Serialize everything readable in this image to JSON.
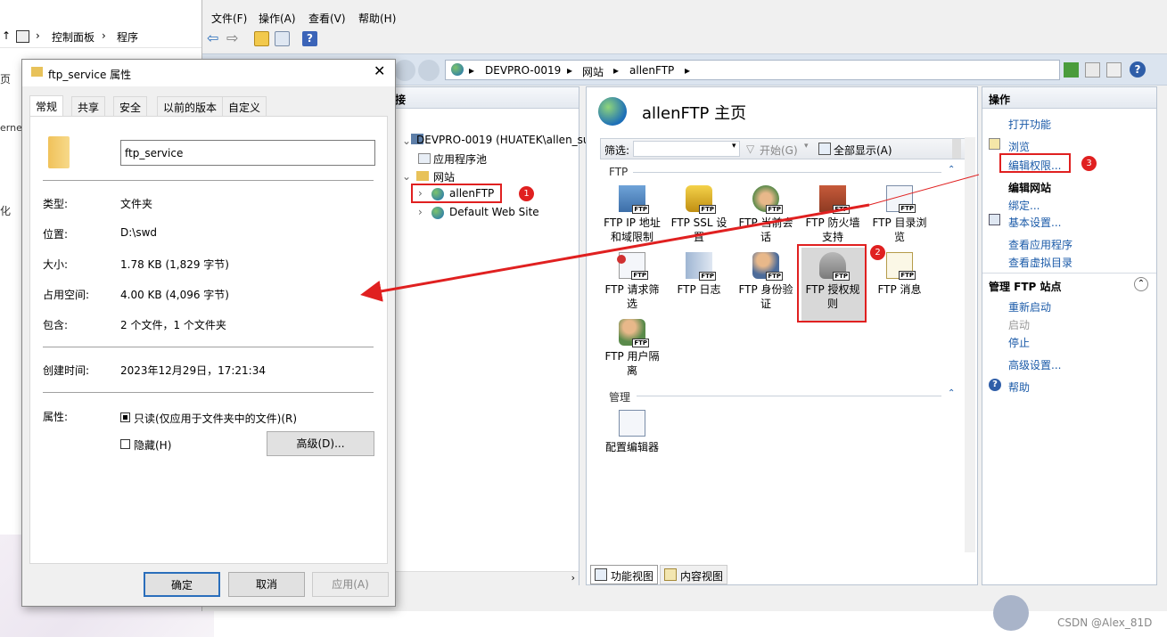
{
  "control_panel": {
    "breadcrumb": [
      "控制面板",
      "程序"
    ],
    "side": [
      "页",
      "ernet",
      "化"
    ]
  },
  "iis": {
    "menu": [
      "文件(F)",
      "操作(A)",
      "查看(V)",
      "帮助(H)"
    ],
    "address": [
      "DEVPRO-0019",
      "网站",
      "allenFTP"
    ],
    "connections": {
      "title": "接",
      "tree": [
        "DEVPRO-0019 (HUATEK\\allen_su",
        "应用程序池",
        "网站",
        "allenFTP",
        "Default Web Site"
      ]
    },
    "center": {
      "title": "allenFTP 主页",
      "filter_label": "筛选:",
      "start_label": "开始(G)",
      "showall_label": "全部显示(A)",
      "section_ftp": "FTP",
      "section_manage": "管理",
      "features": [
        "FTP IP 地址和域限制",
        "FTP SSL 设置",
        "FTP 当前会话",
        "FTP 防火墙支持",
        "FTP 目录浏览",
        "FTP 请求筛选",
        "FTP 日志",
        "FTP 身份验证",
        "FTP 授权规则",
        "FTP 消息",
        "FTP 用户隔离"
      ],
      "manage_features": [
        "配置编辑器"
      ],
      "tabs": [
        "功能视图",
        "内容视图"
      ]
    },
    "actions": {
      "title": "操作",
      "open_feature": "打开功能",
      "browse": "浏览",
      "edit_permissions": "编辑权限...",
      "edit_site_header": "编辑网站",
      "bindings": "绑定...",
      "basic_settings": "基本设置...",
      "view_apps": "查看应用程序",
      "view_vdirs": "查看虚拟目录",
      "manage_header": "管理 FTP 站点",
      "restart": "重新启动",
      "start": "启动",
      "stop": "停止",
      "advanced": "高级设置...",
      "help": "帮助"
    }
  },
  "dialog": {
    "title": "ftp_service 属性",
    "tabs": [
      "常规",
      "共享",
      "安全",
      "以前的版本",
      "自定义"
    ],
    "name": "ftp_service",
    "fields": [
      {
        "label": "类型:",
        "value": "文件夹"
      },
      {
        "label": "位置:",
        "value": "D:\\swd"
      },
      {
        "label": "大小:",
        "value": "1.78 KB (1,829 字节)"
      },
      {
        "label": "占用空间:",
        "value": "4.00 KB (4,096 字节)"
      },
      {
        "label": "包含:",
        "value": "2 个文件，1 个文件夹"
      },
      {
        "label": "创建时间:",
        "value": "2023年12月29日，17:21:34"
      }
    ],
    "attributes_label": "属性:",
    "readonly": "只读(仅应用于文件夹中的文件)(R)",
    "hidden": "隐藏(H)",
    "advanced": "高级(D)...",
    "ok": "确定",
    "cancel": "取消",
    "apply": "应用(A)"
  },
  "badges": [
    "1",
    "2",
    "3"
  ],
  "watermark": "CSDN @Alex_81D",
  "colors": {
    "annotation": "#e02020",
    "link": "#1a5aa8"
  }
}
